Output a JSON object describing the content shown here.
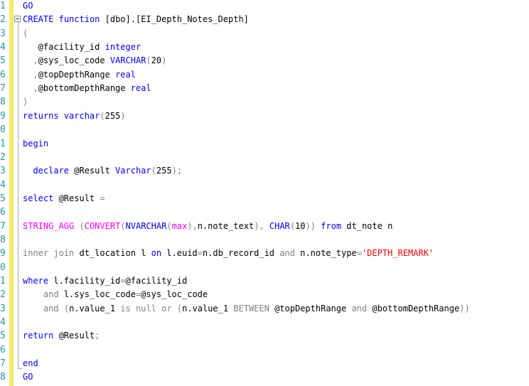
{
  "editor": {
    "line_numbers": [
      "1",
      "2",
      "3",
      "4",
      "5",
      "6",
      "7",
      "8",
      "9",
      "0",
      "1",
      "2",
      "3",
      "4",
      "5",
      "6",
      "7",
      "8",
      "9",
      "0",
      "1",
      "2",
      "3",
      "4",
      "5",
      "6",
      "7",
      "8"
    ],
    "colors": {
      "keyword": "#0000ff",
      "function": "#ff00ff",
      "operator": "#808080",
      "string": "#ff0000",
      "line_number": "#2b91af",
      "change_bar": "#f2ed6e"
    },
    "lines": [
      [
        {
          "t": "kw",
          "v": "GO"
        }
      ],
      [
        {
          "t": "kw",
          "v": "CREATE"
        },
        {
          "t": "id",
          "v": " "
        },
        {
          "t": "kw",
          "v": "function"
        },
        {
          "t": "id",
          "v": " [dbo].[EI_Depth_Notes_Depth]"
        }
      ],
      [
        {
          "t": "op",
          "v": "("
        }
      ],
      [
        {
          "t": "id",
          "v": "   @facility_id "
        },
        {
          "t": "kw",
          "v": "integer"
        }
      ],
      [
        {
          "t": "op",
          "v": "  ,"
        },
        {
          "t": "id",
          "v": "@sys_loc_code "
        },
        {
          "t": "kw",
          "v": "VARCHAR"
        },
        {
          "t": "op",
          "v": "("
        },
        {
          "t": "id",
          "v": "20"
        },
        {
          "t": "op",
          "v": ")"
        }
      ],
      [
        {
          "t": "op",
          "v": "  ,"
        },
        {
          "t": "id",
          "v": "@topDepthRange "
        },
        {
          "t": "kw",
          "v": "real"
        }
      ],
      [
        {
          "t": "op",
          "v": "  ,"
        },
        {
          "t": "id",
          "v": "@bottomDepthRange "
        },
        {
          "t": "kw",
          "v": "real"
        }
      ],
      [
        {
          "t": "op",
          "v": ")"
        }
      ],
      [
        {
          "t": "kw",
          "v": "returns"
        },
        {
          "t": "id",
          "v": " "
        },
        {
          "t": "kw",
          "v": "varchar"
        },
        {
          "t": "op",
          "v": "("
        },
        {
          "t": "id",
          "v": "255"
        },
        {
          "t": "op",
          "v": ")"
        }
      ],
      [],
      [
        {
          "t": "kw",
          "v": "begin"
        }
      ],
      [],
      [
        {
          "t": "id",
          "v": "  "
        },
        {
          "t": "kw",
          "v": "declare"
        },
        {
          "t": "id",
          "v": " @Result "
        },
        {
          "t": "kw",
          "v": "Varchar"
        },
        {
          "t": "op",
          "v": "("
        },
        {
          "t": "id",
          "v": "255"
        },
        {
          "t": "op",
          "v": ");"
        }
      ],
      [],
      [
        {
          "t": "kw",
          "v": "select"
        },
        {
          "t": "id",
          "v": " @Result "
        },
        {
          "t": "op",
          "v": "="
        }
      ],
      [],
      [
        {
          "t": "fn",
          "v": "STRING_AGG"
        },
        {
          "t": "id",
          "v": " "
        },
        {
          "t": "op",
          "v": "("
        },
        {
          "t": "fn",
          "v": "CONVERT"
        },
        {
          "t": "op",
          "v": "("
        },
        {
          "t": "kw",
          "v": "NVARCHAR"
        },
        {
          "t": "op",
          "v": "("
        },
        {
          "t": "fn",
          "v": "max"
        },
        {
          "t": "op",
          "v": "),"
        },
        {
          "t": "id",
          "v": "n.note_text"
        },
        {
          "t": "op",
          "v": "),"
        },
        {
          "t": "id",
          "v": " "
        },
        {
          "t": "kw",
          "v": "CHAR"
        },
        {
          "t": "op",
          "v": "("
        },
        {
          "t": "id",
          "v": "10"
        },
        {
          "t": "op",
          "v": "))"
        },
        {
          "t": "id",
          "v": " "
        },
        {
          "t": "kw",
          "v": "from"
        },
        {
          "t": "id",
          "v": " dt_note n"
        }
      ],
      [],
      [
        {
          "t": "op",
          "v": "inner join"
        },
        {
          "t": "id",
          "v": " dt_location l "
        },
        {
          "t": "kw",
          "v": "on"
        },
        {
          "t": "id",
          "v": " l.euid"
        },
        {
          "t": "op",
          "v": "="
        },
        {
          "t": "id",
          "v": "n.db_record_id "
        },
        {
          "t": "op",
          "v": "and"
        },
        {
          "t": "id",
          "v": " n.note_type"
        },
        {
          "t": "op",
          "v": "="
        },
        {
          "t": "str",
          "v": "'DEPTH_REMARK'"
        }
      ],
      [],
      [
        {
          "t": "kw",
          "v": "where"
        },
        {
          "t": "id",
          "v": " l.facility_id"
        },
        {
          "t": "op",
          "v": "="
        },
        {
          "t": "id",
          "v": "@facility_id"
        }
      ],
      [
        {
          "t": "id",
          "v": "    "
        },
        {
          "t": "op",
          "v": "and"
        },
        {
          "t": "id",
          "v": " l.sys_loc_code"
        },
        {
          "t": "op",
          "v": "="
        },
        {
          "t": "id",
          "v": "@sys_loc_code"
        }
      ],
      [
        {
          "t": "id",
          "v": "    "
        },
        {
          "t": "op",
          "v": "and"
        },
        {
          "t": "id",
          "v": " "
        },
        {
          "t": "op",
          "v": "("
        },
        {
          "t": "id",
          "v": "n.value_1 "
        },
        {
          "t": "op",
          "v": "is null or"
        },
        {
          "t": "id",
          "v": " "
        },
        {
          "t": "op",
          "v": "("
        },
        {
          "t": "id",
          "v": "n.value_1 "
        },
        {
          "t": "op",
          "v": "BETWEEN"
        },
        {
          "t": "id",
          "v": " @topDepthRange "
        },
        {
          "t": "op",
          "v": "and"
        },
        {
          "t": "id",
          "v": " @bottomDepthRange"
        },
        {
          "t": "op",
          "v": "))"
        }
      ],
      [],
      [
        {
          "t": "kw",
          "v": "return"
        },
        {
          "t": "id",
          "v": " @Result"
        },
        {
          "t": "op",
          "v": ";"
        }
      ],
      [],
      [
        {
          "t": "kw",
          "v": "end"
        }
      ],
      [
        {
          "t": "kw",
          "v": "GO"
        }
      ]
    ]
  }
}
